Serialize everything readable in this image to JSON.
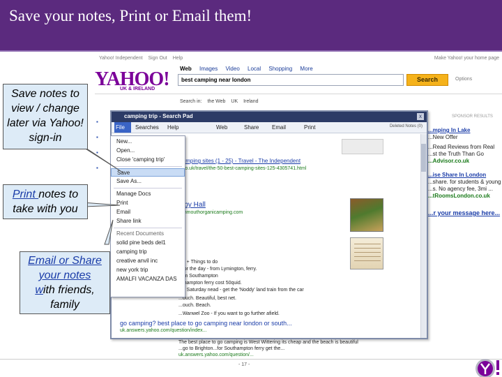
{
  "slide": {
    "title": "Save your notes, Print or Email them!",
    "page_number": "- 17 -"
  },
  "yahoo": {
    "top_links": [
      "Yahoo! Independent",
      "Sign Out",
      "Help"
    ],
    "top_right": "Make Yahoo! your home page",
    "logo_text": "YAHOO!",
    "logo_sub": "UK & IRELAND",
    "tabs": [
      "Web",
      "Images",
      "Video",
      "Local",
      "Shopping",
      "More"
    ],
    "query": "best camping near london",
    "search_button": "Search",
    "options_label": "Options",
    "search_in": [
      "Search in:",
      "the Web",
      "UK",
      "Ireland"
    ],
    "sponsor_label": "SPONSOR RESULTS"
  },
  "search_pad": {
    "title": "camping trip - Search Pad",
    "close_glyph": "x",
    "menu": [
      "File",
      "Searches",
      "Help"
    ],
    "toolbar": [
      "Web",
      "Share",
      "Email",
      "Print"
    ],
    "deleted_notes": "Deleted Notes (0)",
    "body_lines": [
      "Camping sites (1 - 25) - Travel - The Independent",
      "...co.uk/travel/the-50-best-camping-sites-125-4305741.html",
      "...by Hall",
      "...mmouthorganicamping.com",
      "...g + Things to do",
      "...for the day - from Lymington, ferry.",
      "...im Southampton",
      "...thampton ferry cost 50quid.",
      "...g Saturday nead - get the 'Noddy' land train from the car",
      "...ouch. Beautiful, best net.",
      "...ouch. Beach.",
      "...Wanwel Zoo - If you want to go further afield.",
      "go camping? best place to go camping near london or south...",
      "uk.answers.yahoo.com/question/index...",
      "...uk.answers.yahoo.com"
    ]
  },
  "file_menu": {
    "items": [
      "New...",
      "Open...",
      "Close 'camping trip'",
      "Save",
      "Save As...",
      "Manage Docs",
      "Print",
      "Email",
      "Share link",
      "Recent Documents",
      "solid pine beds del1",
      "camping trip",
      "creative anvil inc",
      "new york trip",
      "AMALFI VACANZA DAS"
    ],
    "highlighted": "Save"
  },
  "ads": [
    {
      "head": "...mping In Lake",
      "body": "...New Offer",
      "url": ""
    },
    {
      "head": "",
      "body": "...Read Reviews from Real ...st the Truth Than Go",
      "url": "...Advisor.co.uk"
    },
    {
      "head": "...ise Share In London",
      "body": "...share. for students & young ...s. No agency fee, 3mi ...",
      "url": "...tRoomsLondon.co.uk"
    }
  ],
  "ad_link": "...r your message here...",
  "bottom_text": {
    "line1": "The best place to go camping is West Wittering its cheap and the beach is beautiful",
    "line2": "...go to Brighton...for Southampton ferry get the...",
    "url": "uk.answers.yahoo.com/question/..."
  },
  "callouts": {
    "save": "Save notes to view / change later via Yahoo! sign-in",
    "print_link": "Print ",
    "print_rest": "notes to take with you",
    "email_line1": "Email or Share",
    "email_line2": "your notes",
    "email_line3_link": "w",
    "email_line3_rest": "ith friends,",
    "email_line4": "family"
  },
  "colors": {
    "title_bar": "#5b2a7e",
    "yahoo_purple": "#7b0099",
    "pad_title": "#2c3b66",
    "callout_fill": "#ddebf7",
    "search_button": "#f5b21b"
  }
}
